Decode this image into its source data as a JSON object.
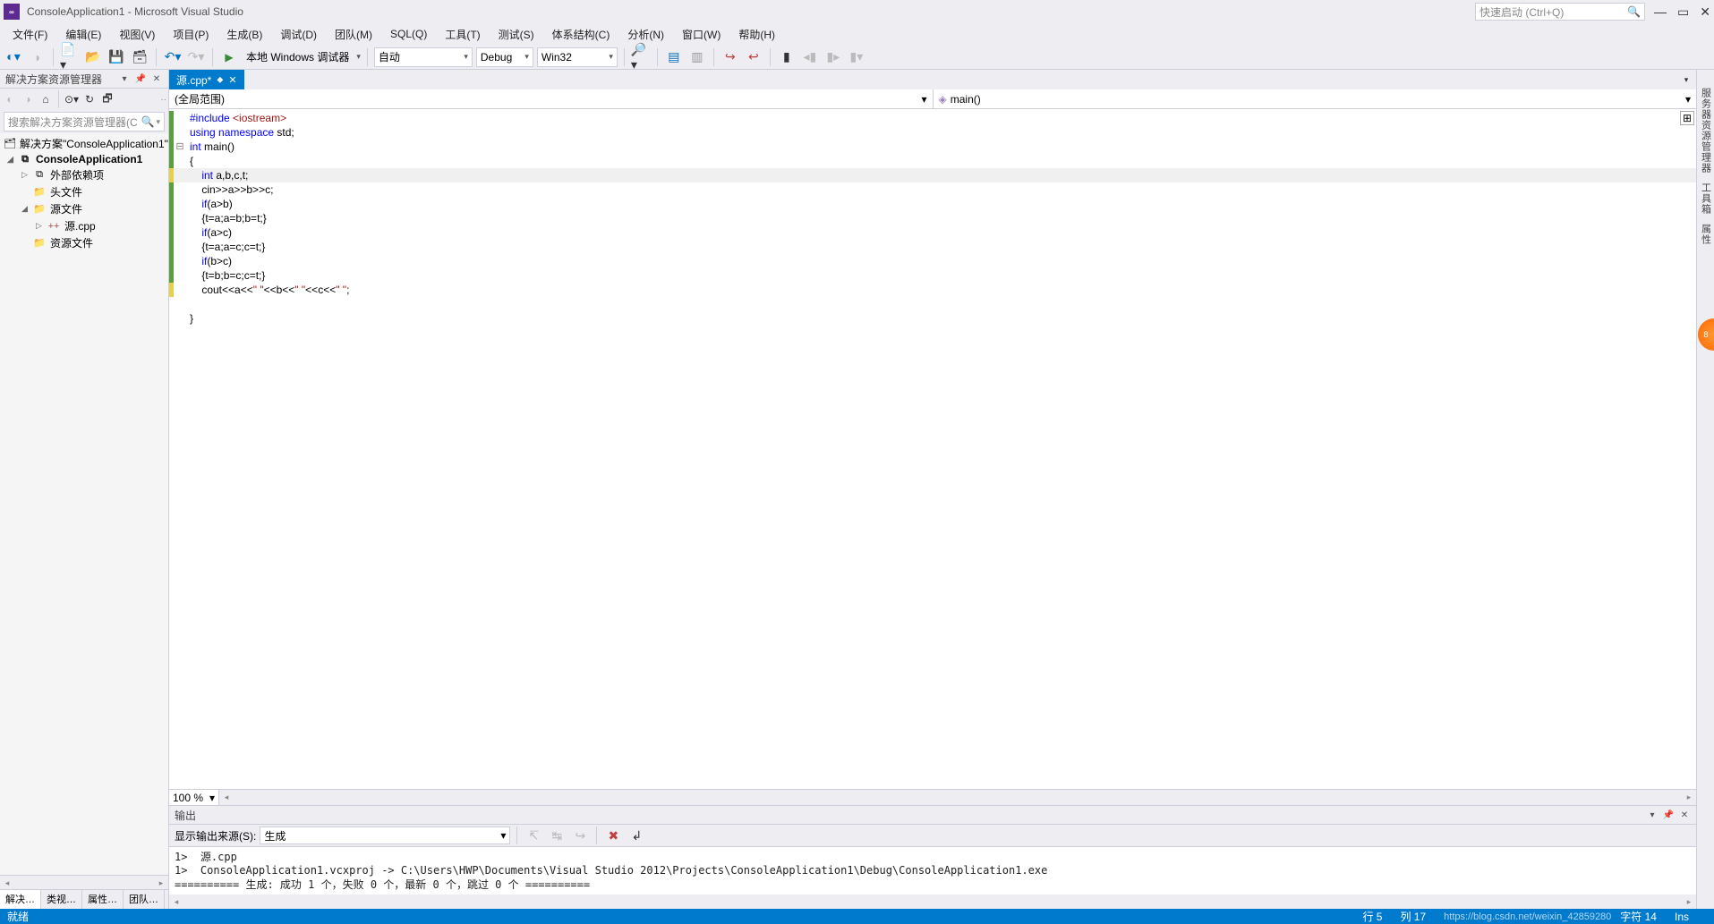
{
  "title": "ConsoleApplication1 - Microsoft Visual Studio",
  "quick_launch_placeholder": "快速启动 (Ctrl+Q)",
  "menu": [
    "文件(F)",
    "编辑(E)",
    "视图(V)",
    "项目(P)",
    "生成(B)",
    "调试(D)",
    "团队(M)",
    "SQL(Q)",
    "工具(T)",
    "测试(S)",
    "体系结构(C)",
    "分析(N)",
    "窗口(W)",
    "帮助(H)"
  ],
  "toolbar": {
    "debug_target": "本地 Windows 调试器",
    "solution_config": "自动",
    "configuration": "Debug",
    "platform": "Win32"
  },
  "solution_explorer": {
    "title": "解决方案资源管理器",
    "search_placeholder": "搜索解决方案资源管理器(C",
    "nodes": {
      "solution": "解决方案\"ConsoleApplication1\"",
      "project": "ConsoleApplication1",
      "external": "外部依赖项",
      "headers": "头文件",
      "sources": "源文件",
      "source_cpp": "源.cpp",
      "resources": "资源文件"
    },
    "tabs": [
      "解决…",
      "类视…",
      "属性…",
      "团队…"
    ]
  },
  "editor": {
    "tab_name": "源.cpp*",
    "scope_left": "(全局范围)",
    "scope_right": "main()",
    "zoom": "100 %",
    "code": [
      {
        "bar": "green",
        "outline": "",
        "text_html": "<span class='kw'>#include</span> <span class='str'>&lt;iostream&gt;</span>"
      },
      {
        "bar": "green",
        "outline": "",
        "text_html": "<span class='kw'>using</span> <span class='kw'>namespace</span> std;"
      },
      {
        "bar": "green",
        "outline": "⊟",
        "text_html": "<span class='kw'>int</span> main()"
      },
      {
        "bar": "green",
        "outline": "",
        "text_html": "{"
      },
      {
        "bar": "yellow",
        "outline": "",
        "highlight": true,
        "text_html": "    <span class='kw'>int</span> a,b,c,t;"
      },
      {
        "bar": "green",
        "outline": "",
        "text_html": "    cin>>a>>b>>c;"
      },
      {
        "bar": "green",
        "outline": "",
        "text_html": "    <span class='kw'>if</span>(a>b)"
      },
      {
        "bar": "green",
        "outline": "",
        "text_html": "    {t=a;a=b;b=t;}"
      },
      {
        "bar": "green",
        "outline": "",
        "text_html": "    <span class='kw'>if</span>(a>c)"
      },
      {
        "bar": "green",
        "outline": "",
        "text_html": "    {t=a;a=c;c=t;}"
      },
      {
        "bar": "green",
        "outline": "",
        "text_html": "    <span class='kw'>if</span>(b>c)"
      },
      {
        "bar": "green",
        "outline": "",
        "text_html": "    {t=b;b=c;c=t;}"
      },
      {
        "bar": "yellow",
        "outline": "",
        "text_html": "    cout&lt;&lt;a&lt;&lt;<span class='str'>\" \"</span>&lt;&lt;b&lt;&lt;<span class='str'>\" \"</span>&lt;&lt;c&lt;&lt;<span class='str'>\" \"</span>;"
      },
      {
        "bar": "",
        "outline": "",
        "text_html": ""
      },
      {
        "bar": "",
        "outline": "",
        "text_html": "}"
      }
    ]
  },
  "output": {
    "title": "输出",
    "source_label": "显示输出来源(S):",
    "source_value": "生成",
    "lines": [
      "1>  源.cpp",
      "1>  ConsoleApplication1.vcxproj -> C:\\Users\\HWP\\Documents\\Visual Studio 2012\\Projects\\ConsoleApplication1\\Debug\\ConsoleApplication1.exe",
      "========== 生成: 成功 1 个，失败 0 个，最新 0 个，跳过 0 个 =========="
    ]
  },
  "right_rail": [
    "服务器资源管理器",
    "工具箱",
    "属性"
  ],
  "statusbar": {
    "ready": "就绪",
    "line": "行 5",
    "col": "列 17",
    "char": "字符 14",
    "ins": "Ins",
    "watermark": "https://blog.csdn.net/weixin_42859280"
  }
}
